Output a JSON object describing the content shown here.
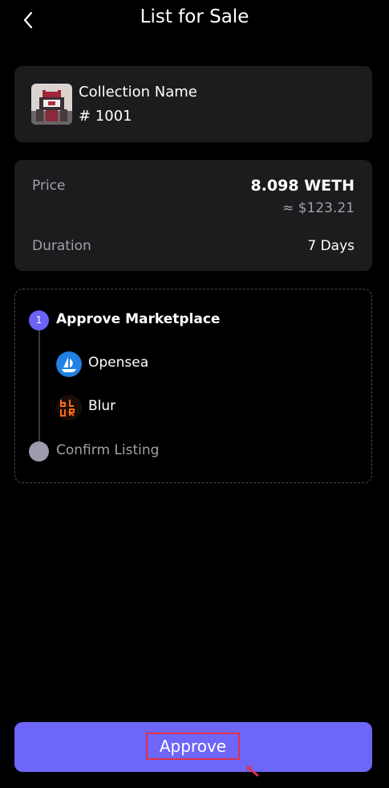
{
  "header": {
    "title": "List for Sale"
  },
  "collection": {
    "name": "Collection Name",
    "token_id": "# 1001"
  },
  "pricing": {
    "price_label": "Price",
    "price_value": "8.098 WETH",
    "price_usd": "≈ $123.21",
    "duration_label": "Duration",
    "duration_value": "7 Days"
  },
  "steps": {
    "step1": {
      "number": "1",
      "title": "Approve Marketplace"
    },
    "marketplaces": [
      {
        "name": "Opensea",
        "icon": "opensea-icon"
      },
      {
        "name": "Blur",
        "icon": "blur-icon"
      }
    ],
    "step2": {
      "title": "Confirm Listing"
    }
  },
  "footer": {
    "approve_label": "Approve"
  },
  "colors": {
    "accent": "#6d66f7",
    "card": "#1c1c1e",
    "highlight": "#e0314a"
  }
}
